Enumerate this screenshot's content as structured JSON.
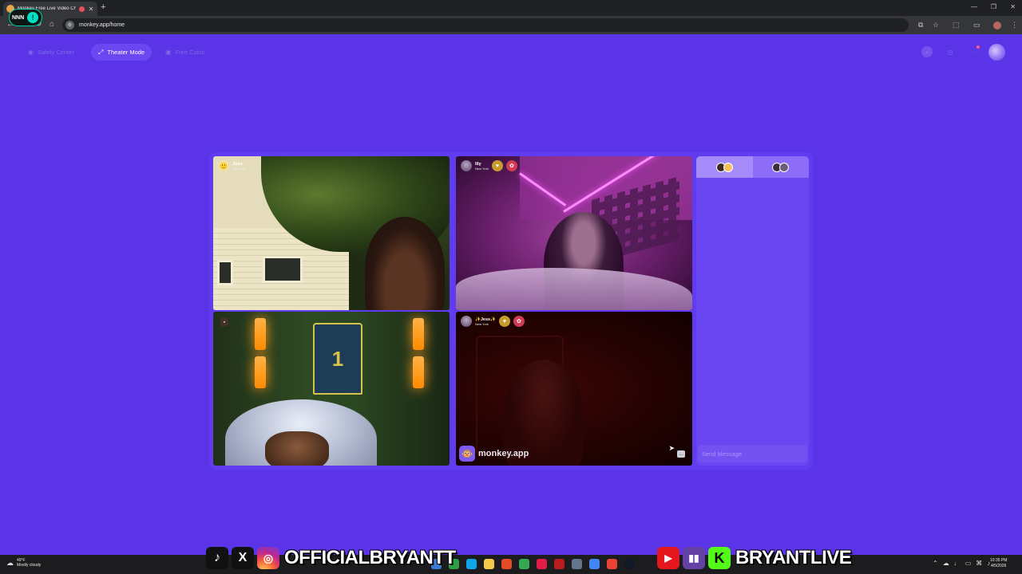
{
  "browser": {
    "tab_title": "Monkey Free Live Video Ch",
    "url": "monkey.app/home",
    "new_tab": "+",
    "minimize": "—",
    "maximize": "❐",
    "close": "✕"
  },
  "streamer_logo": {
    "text": "NNN",
    "mic": "!"
  },
  "header": {
    "safety_center": "Safety Center",
    "theater_mode": "Theater Mode",
    "free_coins": "Free Coins"
  },
  "tiles": [
    {
      "name": "Jose",
      "location": "Maryland"
    },
    {
      "name": "lily",
      "location": "New York"
    },
    {
      "name": "",
      "location": ""
    },
    {
      "name": "✨Jess✨",
      "location": "New York"
    }
  ],
  "watermark": {
    "text": "monkey.app",
    "logo": "🐵"
  },
  "chat": {
    "placeholder": "Send Message"
  },
  "taskbar": {
    "temperature": "49°F",
    "weather": "Mostly cloudy",
    "time": "10:35 PM",
    "date": "4/5/2026",
    "app_colors": [
      "#3a7bd5",
      "#2ea043",
      "#0ea5e9",
      "#f2c94c",
      "#e34c26",
      "#34a853",
      "#e11d48",
      "#b91c1c",
      "#64748b",
      "#4285f4",
      "#ea4335",
      "#111827"
    ]
  },
  "social": {
    "left_handle": "OFFICIALBRYANTT",
    "right_handle": "BRYANTLIVE",
    "tiktok": "♪",
    "x": "X",
    "instagram": "◎",
    "youtube": "▶",
    "twitch": "▮▮",
    "kick": "K"
  },
  "colors": {
    "background": "#5a34e6",
    "stage": "#5f3cef",
    "accent": "#6a47f0"
  }
}
